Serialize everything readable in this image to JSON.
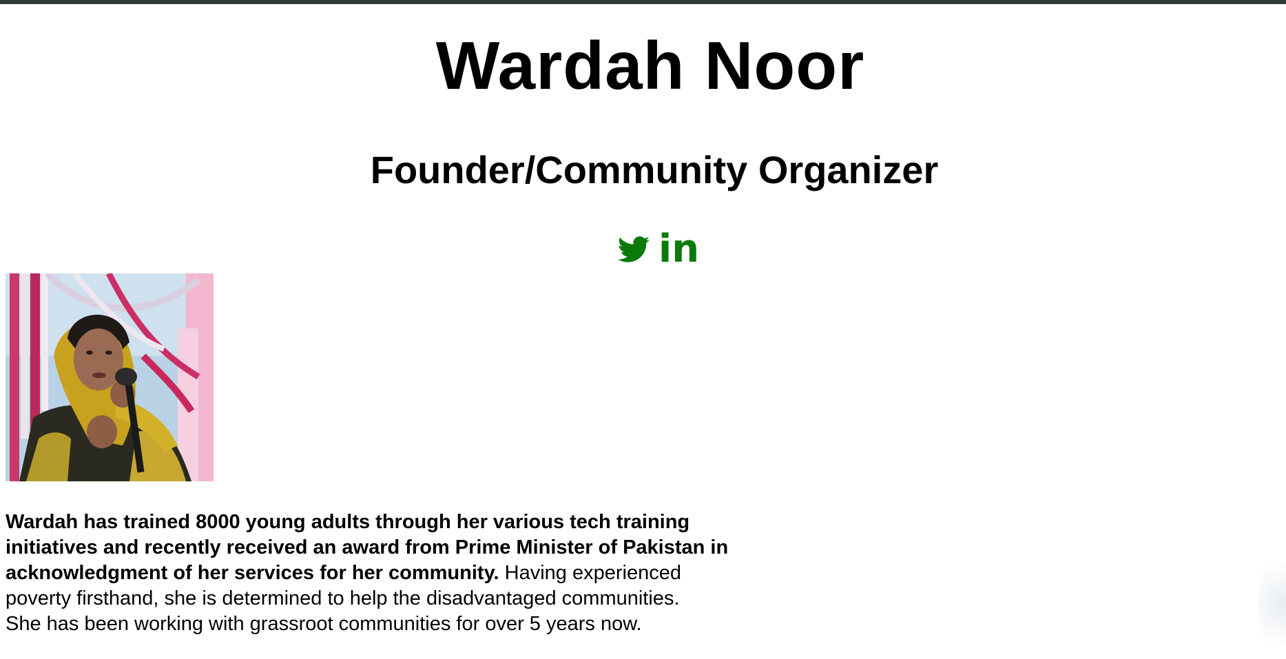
{
  "profile": {
    "name": "Wardah Noor",
    "role": "Founder/Community Organizer"
  },
  "social": {
    "twitter_icon": "twitter-bird-icon",
    "linkedin_label": "in",
    "accent_color": "#0b7a0b"
  },
  "photo": {
    "alt": "Wardah Noor"
  },
  "bio": {
    "bold": "Wardah has trained 8000 young adults through her various tech training initiatives and recently received an award from Prime Minister of Pakistan in acknowledgment of her services for her community.",
    "line_1_rest": " Having experienced",
    "line_2": "poverty firsthand, she is determined to help the disadvantaged communities.",
    "line_3": "She has been working with grassroot communities for over 5 years now."
  },
  "colors": {
    "top_bar": "#2f3a3a",
    "text": "#000000",
    "background": "#ffffff"
  }
}
